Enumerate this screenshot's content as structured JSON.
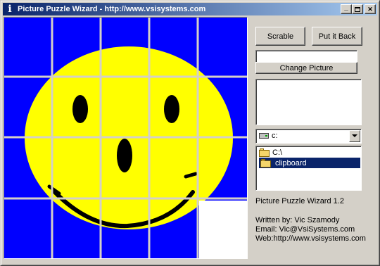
{
  "window": {
    "title": "Picture Puzzle Wizard - http://www.vsisystems.com",
    "icon": "info-i-icon",
    "minimize_glyph": "_",
    "maximize_glyph": "□",
    "close_glyph": "✕"
  },
  "colors": {
    "title_start": "#0a246a",
    "title_end": "#a6caf0",
    "puzzle_bg": "#0000ff",
    "face": "#ffff00",
    "features": "#000000",
    "empty_tile": "#ffffff"
  },
  "puzzle": {
    "rows": 4,
    "cols": 5,
    "empty_tile": {
      "row": 3,
      "col": 4
    }
  },
  "controls": {
    "scramble_label": "Scrable",
    "put_back_label": "Put it Back",
    "path_value": "",
    "change_picture_label": "Change Picture",
    "drive_value": "c:",
    "directories": [
      {
        "label": "C:\\",
        "selected": false
      },
      {
        "label": "clipboard",
        "selected": true
      }
    ]
  },
  "info": {
    "version": "Picture Puzzle Wizard 1.2",
    "author": "Written by: Vic Szamody",
    "email": "Email: Vic@VsiSystems.com",
    "web": "Web:http://www.vsisystems.com"
  }
}
